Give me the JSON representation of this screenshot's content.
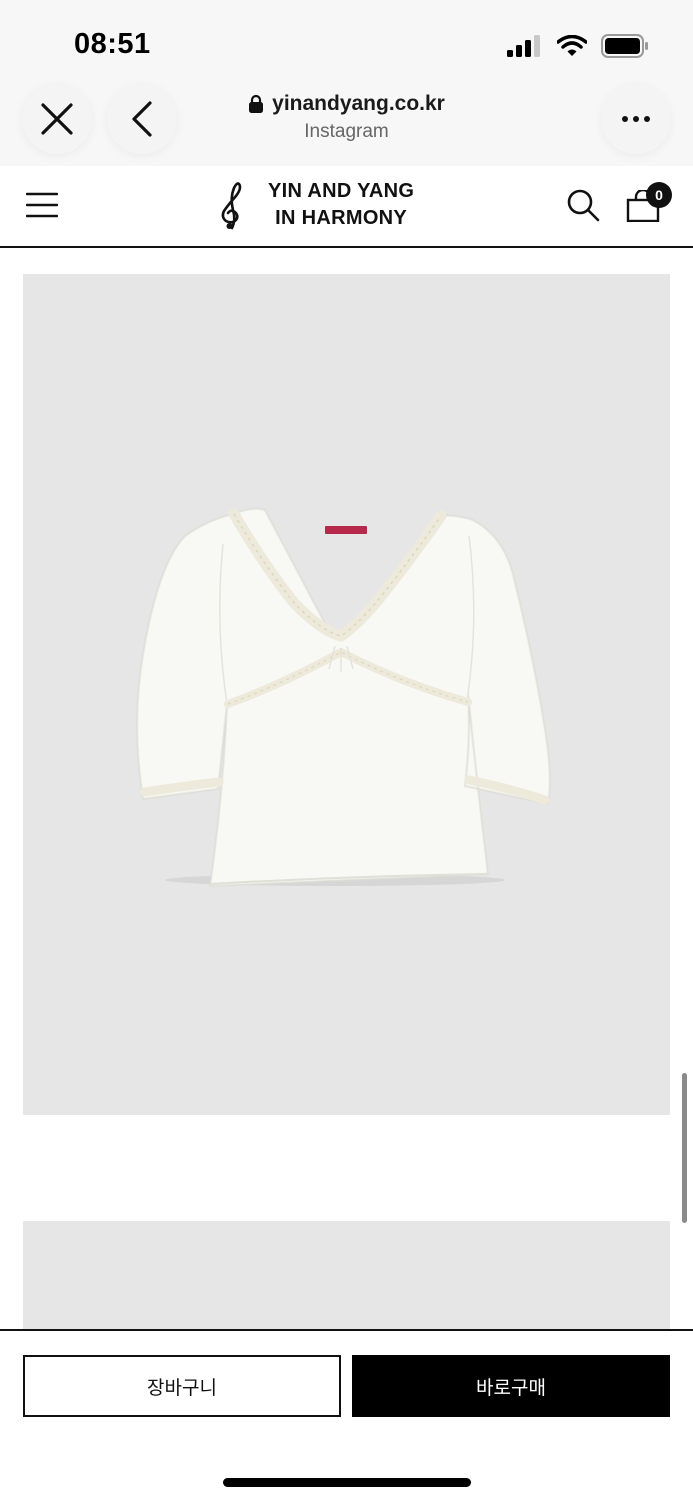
{
  "status_bar": {
    "time": "08:51",
    "icons": [
      "signal-icon",
      "wifi-icon",
      "battery-icon"
    ]
  },
  "browser": {
    "url": "yinandyang.co.kr",
    "source_app": "Instagram",
    "icons": [
      "close-icon",
      "back-chevron-icon",
      "lock-icon",
      "more-icon"
    ]
  },
  "site_header": {
    "logo_line1": "YIN AND YANG",
    "logo_line2": "IN HARMONY",
    "cart_count": "0",
    "icons": [
      "hamburger-menu-icon",
      "treble-clef-logo-icon",
      "search-icon",
      "shopping-bag-icon"
    ]
  },
  "product": {
    "image_subject": "white v-neck lace-trim long sleeve top",
    "colors": {
      "image_bg": "#e6e6e6",
      "top": "#f8f8f4",
      "lace": "#eeeadb",
      "label": "#b8284a"
    }
  },
  "actions": {
    "add_to_cart": "장바구니",
    "buy_now": "바로구매"
  },
  "colors": {
    "primary": "#000000",
    "background": "#ffffff",
    "chrome_bg": "#f7f7f7"
  }
}
